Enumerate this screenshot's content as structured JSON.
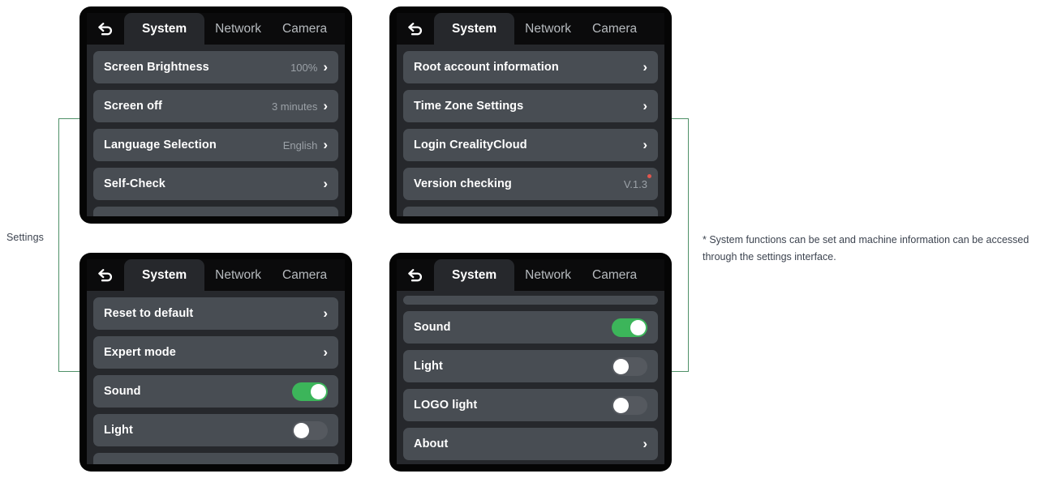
{
  "side_label": "Settings",
  "note": "* System functions can be set and machine information can be accessed through the settings interface.",
  "colors": {
    "toggle_on": "#3cb55a",
    "toggle_off": "#55595f",
    "badge": "#e2564e",
    "bracket": "#4f9168",
    "row_bg": "#484d53",
    "panel_bg": "#26282c",
    "frame": "#050505"
  },
  "tabs": {
    "back_icon": "back-arrow-icon",
    "items": [
      {
        "label": "System",
        "active": true
      },
      {
        "label": "Network",
        "active": false
      },
      {
        "label": "Camera",
        "active": false
      }
    ]
  },
  "panels": [
    {
      "name": "settings-system-page-1",
      "rows": [
        {
          "label": "Screen Brightness",
          "value": "100%",
          "control": "chevron"
        },
        {
          "label": "Screen off",
          "value": "3 minutes",
          "control": "chevron"
        },
        {
          "label": "Language Selection",
          "value": "English",
          "control": "chevron"
        },
        {
          "label": "Self-Check",
          "value": "",
          "control": "chevron"
        },
        {
          "label": "",
          "value": "",
          "control": "partial-bottom"
        }
      ]
    },
    {
      "name": "settings-system-page-2",
      "rows": [
        {
          "label": "Root account information",
          "value": "",
          "control": "chevron"
        },
        {
          "label": "Time Zone Settings",
          "value": "",
          "control": "chevron"
        },
        {
          "label": "Login CrealityCloud",
          "value": "",
          "control": "chevron"
        },
        {
          "label": "Version checking",
          "value": "V.1.3",
          "control": "value-badge"
        },
        {
          "label": "",
          "value": "",
          "control": "partial-bottom"
        }
      ]
    },
    {
      "name": "settings-system-page-3",
      "rows": [
        {
          "label": "Reset to default",
          "value": "",
          "control": "chevron"
        },
        {
          "label": "Expert mode",
          "value": "",
          "control": "chevron"
        },
        {
          "label": "Sound",
          "value": "",
          "control": "toggle-on"
        },
        {
          "label": "Light",
          "value": "",
          "control": "toggle-off"
        },
        {
          "label": "",
          "value": "",
          "control": "partial-bottom"
        }
      ]
    },
    {
      "name": "settings-system-page-4",
      "rows": [
        {
          "label": "",
          "value": "",
          "control": "partial-top"
        },
        {
          "label": "Sound",
          "value": "",
          "control": "toggle-on"
        },
        {
          "label": "Light",
          "value": "",
          "control": "toggle-off"
        },
        {
          "label": "LOGO light",
          "value": "",
          "control": "toggle-off"
        },
        {
          "label": "About",
          "value": "",
          "control": "chevron"
        }
      ]
    }
  ]
}
